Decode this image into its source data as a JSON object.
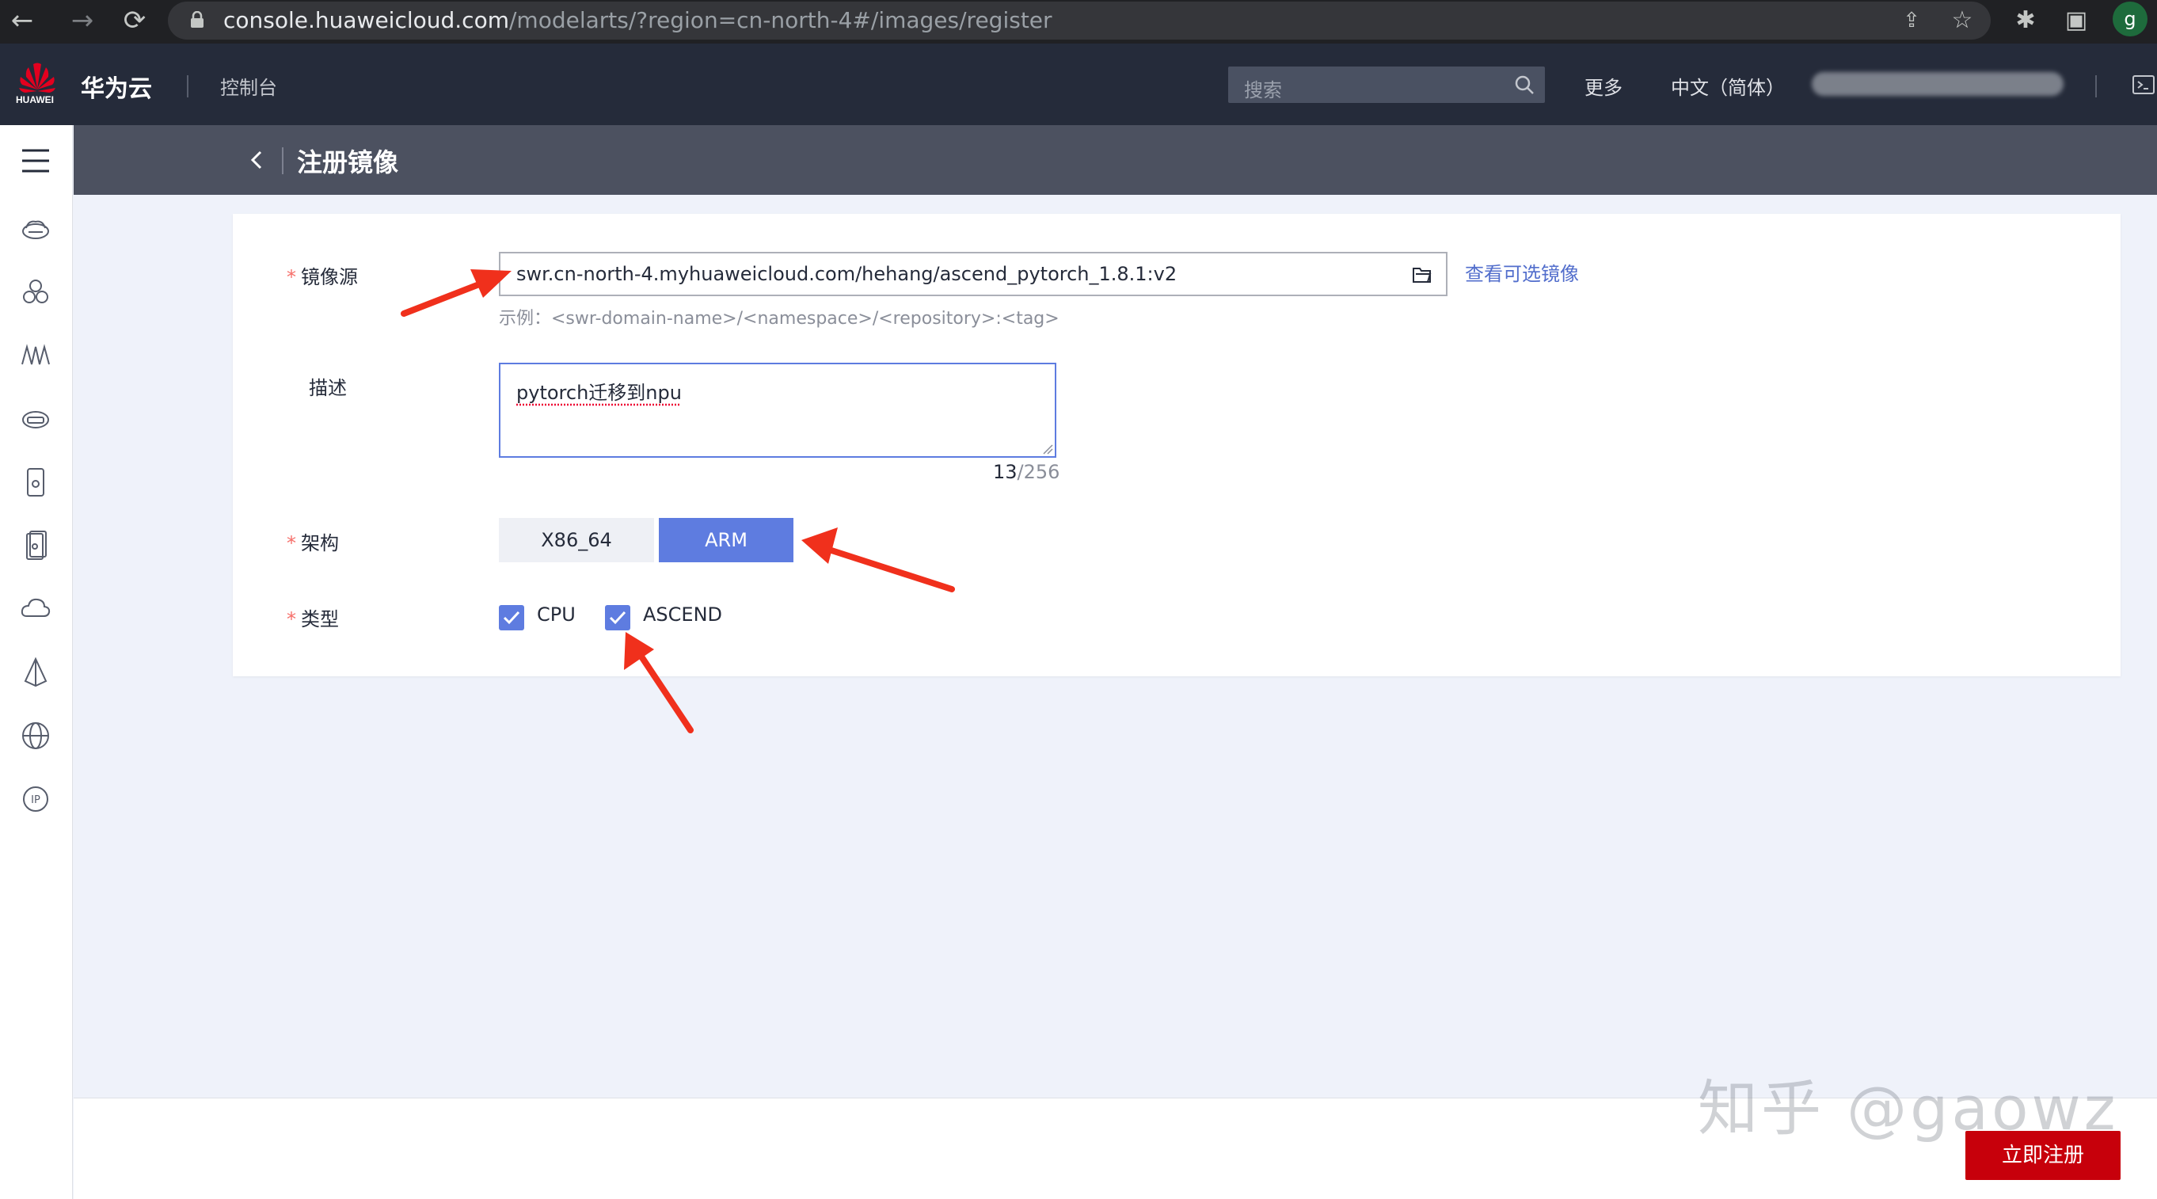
{
  "browser": {
    "url_host": "console.huaweicloud.com",
    "url_path": "/modelarts/?region=cn-north-4#/images/register",
    "profile_initial": "g"
  },
  "topnav": {
    "logo_text": "HUAWEI",
    "brand": "华为云",
    "console": "控制台",
    "search_placeholder": "搜索",
    "more": "更多",
    "language": "中文（简体）"
  },
  "page": {
    "title": "注册镜像"
  },
  "form": {
    "source": {
      "label": "镜像源",
      "required_mark": "*",
      "value": "swr.cn-north-4.myhuaweicloud.com/hehang/ascend_pytorch_1.8.1:v2",
      "link": "查看可选镜像",
      "hint": "示例：<swr-domain-name>/<namespace>/<repository>:<tag>"
    },
    "description": {
      "label": "描述",
      "value": "pytorch迁移到npu",
      "count": "13",
      "max": "/256"
    },
    "architecture": {
      "label": "架构",
      "required_mark": "*",
      "options": [
        "X86_64",
        "ARM"
      ],
      "selected": "ARM"
    },
    "type": {
      "label": "类型",
      "required_mark": "*",
      "options": [
        {
          "label": "CPU",
          "checked": true
        },
        {
          "label": "ASCEND",
          "checked": true
        }
      ]
    }
  },
  "footer": {
    "submit": "立即注册",
    "watermark": "知乎 @gaowz"
  },
  "colors": {
    "accent": "#5e7ce0",
    "brand_red": "#c7000b",
    "topnav_bg": "#252b3a",
    "header_bg": "#4c5160",
    "annotation_arrow": "#f0301c"
  }
}
